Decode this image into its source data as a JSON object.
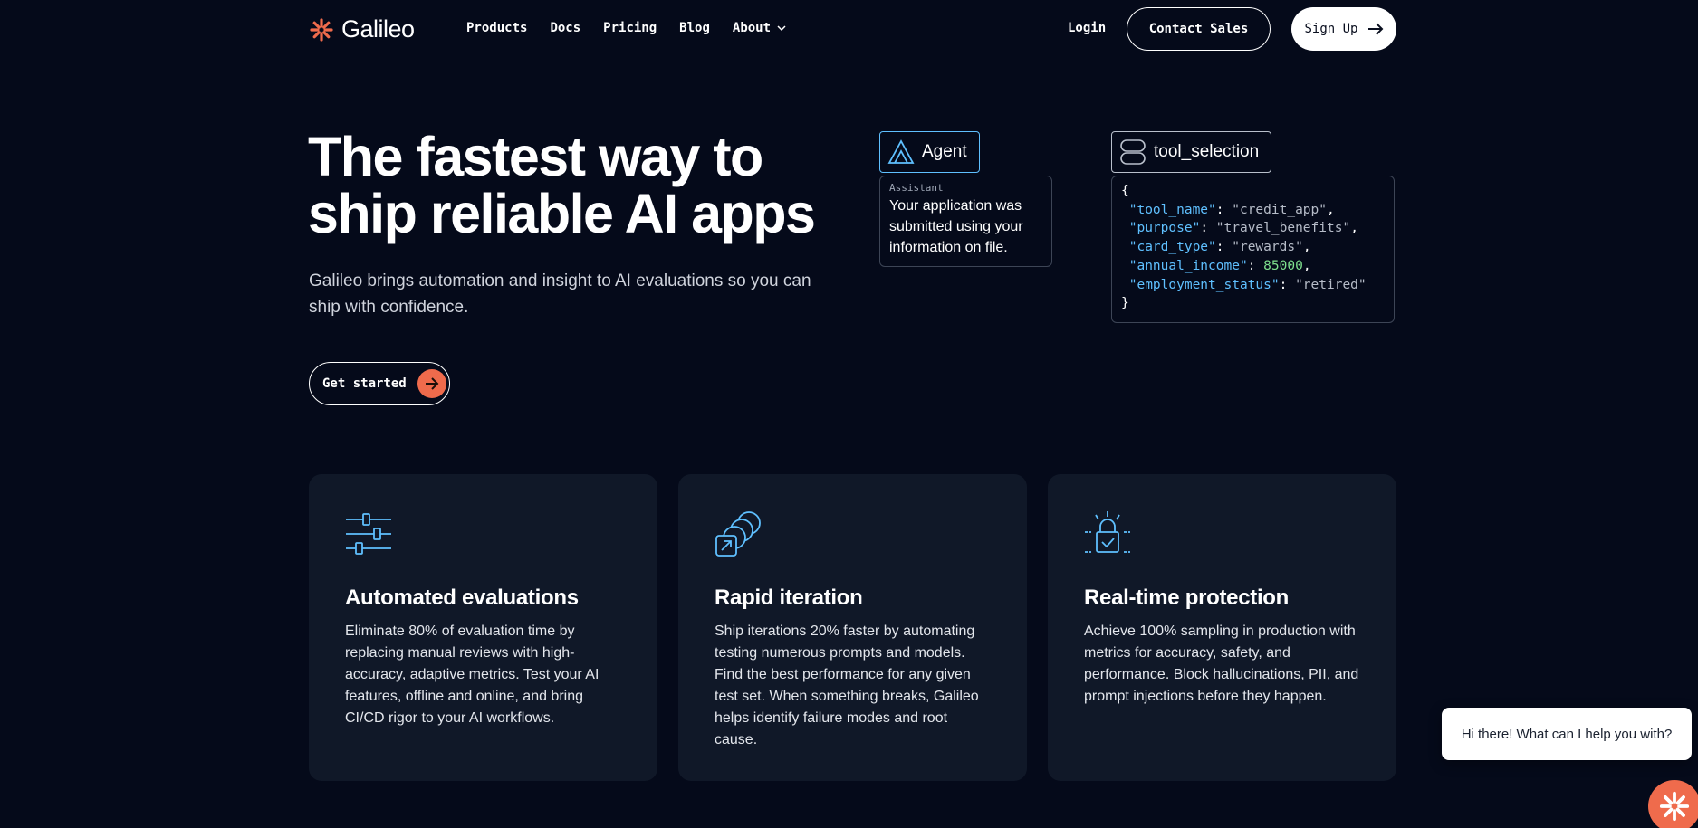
{
  "nav": {
    "brand": "Galileo",
    "links": [
      {
        "label": "Products"
      },
      {
        "label": "Docs"
      },
      {
        "label": "Pricing"
      },
      {
        "label": "Blog"
      },
      {
        "label": "About"
      }
    ],
    "login": "Login",
    "contact_sales": "Contact Sales",
    "sign_up": "Sign Up"
  },
  "hero": {
    "title": "The fastest way to ship reliable AI apps",
    "subtitle": "Galileo brings automation and insight to AI evaluations so you can ship with confidence.",
    "cta": "Get started"
  },
  "agent_demo": {
    "agent_tag": "Agent",
    "role": "Assistant",
    "message": "Your application was submitted using your information on file.",
    "tool_tag": "tool_selection",
    "json_lines": [
      {
        "key": "\"tool_name\"",
        "value": "\"credit_app\"",
        "type": "string",
        "trail": ","
      },
      {
        "key": "\"purpose\"",
        "value": "\"travel_benefits\"",
        "type": "string",
        "trail": ","
      },
      {
        "key": "\"card_type\"",
        "value": "\"rewards\"",
        "type": "string",
        "trail": ","
      },
      {
        "key": "\"annual_income\"",
        "value": "85000",
        "type": "number",
        "trail": ","
      },
      {
        "key": "\"employment_status\"",
        "value": "\"retired\"",
        "type": "string",
        "trail": ""
      }
    ]
  },
  "features": [
    {
      "icon": "sliders-icon",
      "title": "Automated evaluations",
      "text": "Eliminate 80% of evaluation time by replacing manual reviews with high-accuracy, adaptive metrics. Test your AI features, offline and online, and bring CI/CD rigor to your AI workflows."
    },
    {
      "icon": "stacked-arrows-icon",
      "title": "Rapid iteration",
      "text": "Ship iterations 20% faster by automating testing numerous prompts and models. Find the best performance for any given test set. When something breaks, Galileo helps identify failure modes and root cause."
    },
    {
      "icon": "lock-check-icon",
      "title": "Real-time protection",
      "text": "Achieve 100% sampling in production with metrics for accuracy, safety, and performance. Block hallucinations, PII, and prompt injections before they happen."
    }
  ],
  "chat": {
    "greeting": "Hi there! What can I help you with?"
  },
  "colors": {
    "background": "#050a1a",
    "card": "#101828",
    "accent": "#ef6b4c",
    "icon_blue": "#5fc0ff"
  }
}
